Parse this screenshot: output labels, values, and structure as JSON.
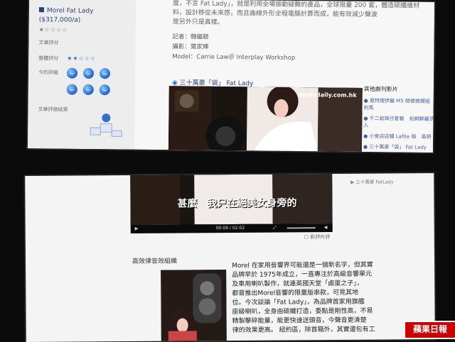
{
  "top": {
    "product_title": "Morel Fat Lady\n($317,000/a)",
    "rating_stars": "★☆☆☆☆",
    "labels": {
      "section_rating": "文章評分",
      "overall": "整體評分",
      "today": "今的評級",
      "result": "文章評語結束"
    },
    "stars_row": "★★☆☆☆",
    "paragraph": "度，不言 Fat Lady」，就是利用全場振動疑難的產品，全球限量 200 套，體造碳纖維材料，設計移從未來感，而且曲線外形全程電腦計算而成，能有效減少聲波",
    "para_more": "是另外只是真樣。",
    "credits": {
      "writer": "記者：韓繼聰",
      "photo": "攝影：葉家輝",
      "model": "Model：Carrie Law＠ Interplay Workshop"
    },
    "video_label": "三十萬豪「袋」 Fat Lady",
    "watermark": "appledaily.com.hk",
    "related": {
      "heading": "其他劇刊影片",
      "items": [
        "● 夏特理伊麗 M5 問候微模組利馬",
        "● 千二蚊珠仔套餐　如網鮮嚴頂入",
        "● 小食店店鋪 Lafite 版　島炳",
        "● 三十萬豪「袋」 Fat Lady"
      ]
    }
  },
  "bottom": {
    "subtitle": "甚麼　我只在絕美女身旁的",
    "time": "00:09 / 02:02",
    "feedback": "影評片評",
    "right_note": "▶ 三十萬豪 FatLady",
    "section_title": "高效律音效組織",
    "article": [
      "Morel 在家用音響界可能還是一個新名字，但其實",
      "品牌早於 1975年成立，一直專注於高級音響單元",
      "及車用喇叭製作，就連英國天堂「鹵蛋之子」，",
      "都曾推出Morel音響的限量版串款，可見其地",
      "位。今次談論「Fat Lady」，為品牌首家用旗艦",
      "座級喇叭，全身由碳纖打造，委點是剛性高，不易",
      "精製擊碎能量，能更快速送頭音，今聲音更清楚",
      "律的效果更高。 紐約區，除首箱外，其實還包有工"
    ],
    "logo": "蘋果日報"
  }
}
